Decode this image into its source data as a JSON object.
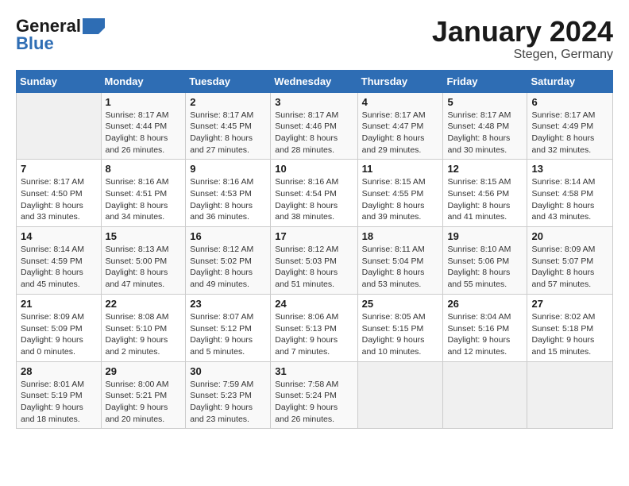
{
  "header": {
    "logo_general": "General",
    "logo_blue": "Blue",
    "month_title": "January 2024",
    "location": "Stegen, Germany"
  },
  "days_of_week": [
    "Sunday",
    "Monday",
    "Tuesday",
    "Wednesday",
    "Thursday",
    "Friday",
    "Saturday"
  ],
  "weeks": [
    [
      {
        "day": "",
        "sunrise": "",
        "sunset": "",
        "daylight": ""
      },
      {
        "day": "1",
        "sunrise": "Sunrise: 8:17 AM",
        "sunset": "Sunset: 4:44 PM",
        "daylight": "Daylight: 8 hours and 26 minutes."
      },
      {
        "day": "2",
        "sunrise": "Sunrise: 8:17 AM",
        "sunset": "Sunset: 4:45 PM",
        "daylight": "Daylight: 8 hours and 27 minutes."
      },
      {
        "day": "3",
        "sunrise": "Sunrise: 8:17 AM",
        "sunset": "Sunset: 4:46 PM",
        "daylight": "Daylight: 8 hours and 28 minutes."
      },
      {
        "day": "4",
        "sunrise": "Sunrise: 8:17 AM",
        "sunset": "Sunset: 4:47 PM",
        "daylight": "Daylight: 8 hours and 29 minutes."
      },
      {
        "day": "5",
        "sunrise": "Sunrise: 8:17 AM",
        "sunset": "Sunset: 4:48 PM",
        "daylight": "Daylight: 8 hours and 30 minutes."
      },
      {
        "day": "6",
        "sunrise": "Sunrise: 8:17 AM",
        "sunset": "Sunset: 4:49 PM",
        "daylight": "Daylight: 8 hours and 32 minutes."
      }
    ],
    [
      {
        "day": "7",
        "sunrise": "Sunrise: 8:17 AM",
        "sunset": "Sunset: 4:50 PM",
        "daylight": "Daylight: 8 hours and 33 minutes."
      },
      {
        "day": "8",
        "sunrise": "Sunrise: 8:16 AM",
        "sunset": "Sunset: 4:51 PM",
        "daylight": "Daylight: 8 hours and 34 minutes."
      },
      {
        "day": "9",
        "sunrise": "Sunrise: 8:16 AM",
        "sunset": "Sunset: 4:53 PM",
        "daylight": "Daylight: 8 hours and 36 minutes."
      },
      {
        "day": "10",
        "sunrise": "Sunrise: 8:16 AM",
        "sunset": "Sunset: 4:54 PM",
        "daylight": "Daylight: 8 hours and 38 minutes."
      },
      {
        "day": "11",
        "sunrise": "Sunrise: 8:15 AM",
        "sunset": "Sunset: 4:55 PM",
        "daylight": "Daylight: 8 hours and 39 minutes."
      },
      {
        "day": "12",
        "sunrise": "Sunrise: 8:15 AM",
        "sunset": "Sunset: 4:56 PM",
        "daylight": "Daylight: 8 hours and 41 minutes."
      },
      {
        "day": "13",
        "sunrise": "Sunrise: 8:14 AM",
        "sunset": "Sunset: 4:58 PM",
        "daylight": "Daylight: 8 hours and 43 minutes."
      }
    ],
    [
      {
        "day": "14",
        "sunrise": "Sunrise: 8:14 AM",
        "sunset": "Sunset: 4:59 PM",
        "daylight": "Daylight: 8 hours and 45 minutes."
      },
      {
        "day": "15",
        "sunrise": "Sunrise: 8:13 AM",
        "sunset": "Sunset: 5:00 PM",
        "daylight": "Daylight: 8 hours and 47 minutes."
      },
      {
        "day": "16",
        "sunrise": "Sunrise: 8:12 AM",
        "sunset": "Sunset: 5:02 PM",
        "daylight": "Daylight: 8 hours and 49 minutes."
      },
      {
        "day": "17",
        "sunrise": "Sunrise: 8:12 AM",
        "sunset": "Sunset: 5:03 PM",
        "daylight": "Daylight: 8 hours and 51 minutes."
      },
      {
        "day": "18",
        "sunrise": "Sunrise: 8:11 AM",
        "sunset": "Sunset: 5:04 PM",
        "daylight": "Daylight: 8 hours and 53 minutes."
      },
      {
        "day": "19",
        "sunrise": "Sunrise: 8:10 AM",
        "sunset": "Sunset: 5:06 PM",
        "daylight": "Daylight: 8 hours and 55 minutes."
      },
      {
        "day": "20",
        "sunrise": "Sunrise: 8:09 AM",
        "sunset": "Sunset: 5:07 PM",
        "daylight": "Daylight: 8 hours and 57 minutes."
      }
    ],
    [
      {
        "day": "21",
        "sunrise": "Sunrise: 8:09 AM",
        "sunset": "Sunset: 5:09 PM",
        "daylight": "Daylight: 9 hours and 0 minutes."
      },
      {
        "day": "22",
        "sunrise": "Sunrise: 8:08 AM",
        "sunset": "Sunset: 5:10 PM",
        "daylight": "Daylight: 9 hours and 2 minutes."
      },
      {
        "day": "23",
        "sunrise": "Sunrise: 8:07 AM",
        "sunset": "Sunset: 5:12 PM",
        "daylight": "Daylight: 9 hours and 5 minutes."
      },
      {
        "day": "24",
        "sunrise": "Sunrise: 8:06 AM",
        "sunset": "Sunset: 5:13 PM",
        "daylight": "Daylight: 9 hours and 7 minutes."
      },
      {
        "day": "25",
        "sunrise": "Sunrise: 8:05 AM",
        "sunset": "Sunset: 5:15 PM",
        "daylight": "Daylight: 9 hours and 10 minutes."
      },
      {
        "day": "26",
        "sunrise": "Sunrise: 8:04 AM",
        "sunset": "Sunset: 5:16 PM",
        "daylight": "Daylight: 9 hours and 12 minutes."
      },
      {
        "day": "27",
        "sunrise": "Sunrise: 8:02 AM",
        "sunset": "Sunset: 5:18 PM",
        "daylight": "Daylight: 9 hours and 15 minutes."
      }
    ],
    [
      {
        "day": "28",
        "sunrise": "Sunrise: 8:01 AM",
        "sunset": "Sunset: 5:19 PM",
        "daylight": "Daylight: 9 hours and 18 minutes."
      },
      {
        "day": "29",
        "sunrise": "Sunrise: 8:00 AM",
        "sunset": "Sunset: 5:21 PM",
        "daylight": "Daylight: 9 hours and 20 minutes."
      },
      {
        "day": "30",
        "sunrise": "Sunrise: 7:59 AM",
        "sunset": "Sunset: 5:23 PM",
        "daylight": "Daylight: 9 hours and 23 minutes."
      },
      {
        "day": "31",
        "sunrise": "Sunrise: 7:58 AM",
        "sunset": "Sunset: 5:24 PM",
        "daylight": "Daylight: 9 hours and 26 minutes."
      },
      {
        "day": "",
        "sunrise": "",
        "sunset": "",
        "daylight": ""
      },
      {
        "day": "",
        "sunrise": "",
        "sunset": "",
        "daylight": ""
      },
      {
        "day": "",
        "sunrise": "",
        "sunset": "",
        "daylight": ""
      }
    ]
  ]
}
